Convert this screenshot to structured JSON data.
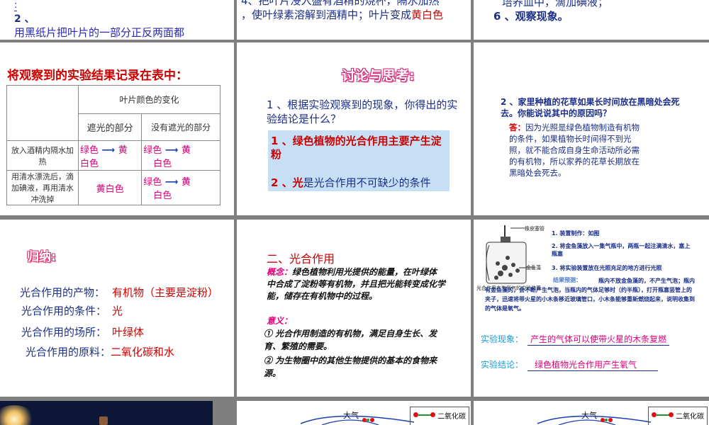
{
  "slide1": {
    "line1": ":",
    "line2": "2 、",
    "line3": "用黑纸片把叶片的一部分正反两面都"
  },
  "slide2": {
    "line1": "4、把叶片浸入盛有酒精的烧杯，隔水加热",
    "line2a": "，使叶绿素溶解到酒精中；叶片变成",
    "line2b": "黄白色"
  },
  "slide3": {
    "line1": "培养皿中，滴加碘液；",
    "line2": "6 、观察现象。"
  },
  "slide4": {
    "title": "将观察到的实验结果记录在表中：",
    "header": "叶片颜色的变化",
    "col1": "遮光的部分",
    "col2": "没有遮光的部分",
    "row1_label": "放入酒精内隔水加热",
    "row1_c1a": "绿色",
    "row1_c1b": "黄",
    "row1_c1c": "白色",
    "row1_c1d": "绿色",
    "row1_c2b": "黄",
    "row1_c2c": "白色",
    "row2_label": "用清水漂洗后，滴加碘液，再用清水冲洗掉",
    "row2_c1": "黄白色",
    "row2_c2a": "绿色",
    "row2_c2b": "黄",
    "row2_c2c": "白色"
  },
  "slide5": {
    "title": "讨论与思考:",
    "question": "1 、根据实验观察到的现象，你得出的实验结论是什么？",
    "answer1": "1 、绿色植物的光合作用主要产生淀粉",
    "answer2a": "2 、光",
    "answer2b": "是光合作用不可缺少的条件"
  },
  "slide6": {
    "question": "2 、家里种植的花草如果长时间放在黑暗处会死去。你能说说其中的原因吗？",
    "answer_label": "答：",
    "answer": "因为光照是绿色植物制造有机物的条件，如果植物长时间得不到光照，就不能合成自身生命活动所必需的有机物，所以家养的花草长期放在黑暗处会死去。"
  },
  "slide7": {
    "title": "归纳:",
    "rows": [
      {
        "label": "光合作用的产物：",
        "value": "有机物（主要是淀粉）"
      },
      {
        "label": "光合作用的条件：",
        "value": "光"
      },
      {
        "label": "光合作用的场所：",
        "value": "叶绿体"
      },
      {
        "label": "光合作用的原料：",
        "value": "二氧化碳和水"
      }
    ]
  },
  "slide8": {
    "title": "二、光合作用",
    "concept_label": "概念：",
    "concept": "绿色植物利用光提供的能量，在叶绿体中合成了淀粉等有机物，并且把光能转变成化学能，储存在有机物中的过程。",
    "meaning_label": "意义：",
    "m1": "① 光合作用制造的有机物，满足自身生长、发育、繁殖的需要。",
    "m2": "② 为生物圈中的其他生物提供的基本的食物来源。"
  },
  "slide9": {
    "label_stopper": "橡皮塞管",
    "label_weed": "金鱼藻",
    "caption": "光合作用产生氧气的实验装置",
    "s1": "1. 装置制作：如图",
    "s2": "2. 将金鱼藻放入一集气瓶中，两瓶一起注满清水，塞上瓶塞",
    "s3": "3. 将实验装置放在光照充足的地方进行光照",
    "predict_label": "结果预测：",
    "predict": "瓶内不放金鱼藻的，不产生气泡；瓶内有金鱼藻的，会不断产生气泡，当瓶内的气体足够时（约半瓶），打开瓶塞竖管上的夹子，迅速将带火星的小木条移近玻璃管口，小木条能够重新燃烧起来，说明收集到的气体是氧气。",
    "phenomenon_label": "实验现象：",
    "phenomenon": "产生的气体可以使带火星的木条复燃",
    "conclusion_label": "实验结论：",
    "conclusion": "绿色植物光合作用产生氧气"
  },
  "slide11": {
    "atmosphere": "大气",
    "legend": "二氧化碳"
  },
  "slide12": {
    "atmosphere": "大气",
    "legend": "二氧化碳"
  }
}
